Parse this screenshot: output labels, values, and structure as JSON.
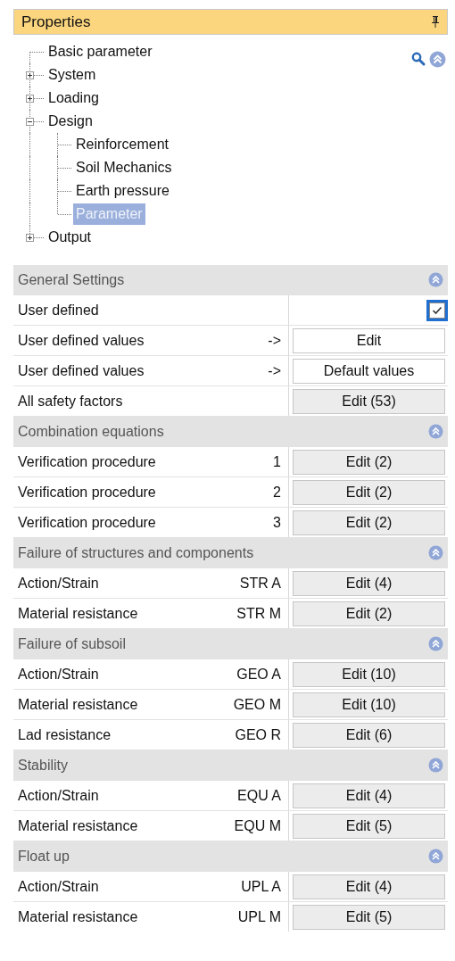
{
  "panel": {
    "title": "Properties"
  },
  "tree": [
    {
      "label": "Basic parameter",
      "selected": false
    },
    {
      "label": "System",
      "expanded": false,
      "selected": false
    },
    {
      "label": "Loading",
      "expanded": false,
      "selected": false
    },
    {
      "label": "Design",
      "expanded": true,
      "selected": false,
      "children": [
        {
          "label": "Reinforcement",
          "selected": false
        },
        {
          "label": "Soil Mechanics",
          "selected": false
        },
        {
          "label": "Earth pressure",
          "selected": false
        },
        {
          "label": "Parameter",
          "selected": true
        }
      ]
    },
    {
      "label": "Output",
      "expanded": false,
      "selected": false
    }
  ],
  "sections": [
    {
      "title": "General Settings",
      "rows": [
        {
          "label": "User defined",
          "kind": "checkbox",
          "checked": true
        },
        {
          "label": "User defined values",
          "value": "->",
          "kind": "plain-button",
          "button": "Edit"
        },
        {
          "label": "User defined values",
          "value": "->",
          "kind": "plain-button",
          "button": "Default values"
        },
        {
          "label": "All safety factors",
          "kind": "button",
          "button": "Edit (53)"
        }
      ]
    },
    {
      "title": "Combination equations",
      "rows": [
        {
          "label": "Verification procedure",
          "value": "1",
          "kind": "button",
          "button": "Edit (2)"
        },
        {
          "label": "Verification procedure",
          "value": "2",
          "kind": "button",
          "button": "Edit (2)"
        },
        {
          "label": "Verification procedure",
          "value": "3",
          "kind": "button",
          "button": "Edit (2)"
        }
      ]
    },
    {
      "title": "Failure of structures and components",
      "rows": [
        {
          "label": "Action/Strain",
          "value": "STR A",
          "kind": "button",
          "button": "Edit (4)"
        },
        {
          "label": "Material resistance",
          "value": "STR M",
          "kind": "button",
          "button": "Edit (2)"
        }
      ]
    },
    {
      "title": "Failure of subsoil",
      "rows": [
        {
          "label": "Action/Strain",
          "value": "GEO A",
          "kind": "button",
          "button": "Edit (10)"
        },
        {
          "label": "Material resistance",
          "value": "GEO M",
          "kind": "button",
          "button": "Edit (10)"
        },
        {
          "label": "Lad resistance",
          "value": "GEO R",
          "kind": "button",
          "button": "Edit (6)"
        }
      ]
    },
    {
      "title": "Stability",
      "rows": [
        {
          "label": "Action/Strain",
          "value": "EQU A",
          "kind": "button",
          "button": "Edit (4)"
        },
        {
          "label": "Material resistance",
          "value": "EQU M",
          "kind": "button",
          "button": "Edit (5)"
        }
      ]
    },
    {
      "title": "Float up",
      "rows": [
        {
          "label": "Action/Strain",
          "value": "UPL A",
          "kind": "button",
          "button": "Edit (4)"
        },
        {
          "label": "Material resistance",
          "value": "UPL M",
          "kind": "button",
          "button": "Edit (5)"
        }
      ]
    }
  ]
}
